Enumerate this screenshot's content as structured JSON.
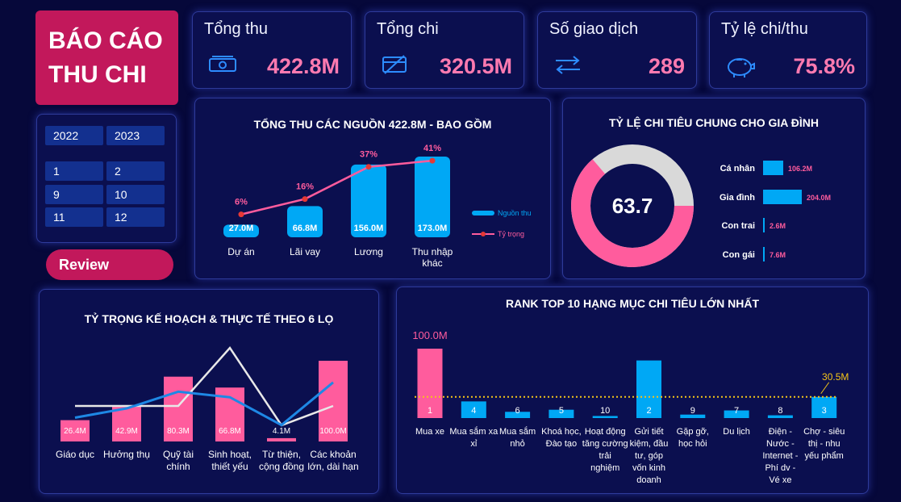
{
  "header": {
    "title_line1": "BÁO CÁO",
    "title_line2": "THU CHI"
  },
  "kpis": [
    {
      "label": "Tổng thu",
      "value": "422.8M",
      "icon": "money-icon"
    },
    {
      "label": "Tổng chi",
      "value": "320.5M",
      "icon": "card-icon"
    },
    {
      "label": "Số giao dịch",
      "value": "289",
      "icon": "transfer-icon"
    },
    {
      "label": "Tỷ lệ chi/thu",
      "value": "75.8%",
      "icon": "piggy-bank-icon"
    }
  ],
  "filters": {
    "years": [
      "2022",
      "2023"
    ],
    "months": [
      "1",
      "2",
      "9",
      "10",
      "11",
      "12"
    ]
  },
  "review_label": "Review",
  "colors": {
    "pink": "#ff5c9d",
    "blue": "#00a8f5",
    "accent": "#c2185b",
    "grey": "#d9d9d9"
  },
  "chart_data": [
    {
      "type": "bar",
      "title": "TỔNG THU CÁC NGUỒN 422.8M - BAO GỒM",
      "categories": [
        "Dự án",
        "Lãi vay",
        "Lương",
        "Thu nhập khác"
      ],
      "series": [
        {
          "name": "Nguồn thu",
          "values": [
            27.0,
            66.8,
            156.0,
            173.0
          ],
          "labels": [
            "27.0M",
            "66.8M",
            "156.0M",
            "173.0M"
          ]
        },
        {
          "name": "Tỷ trọng",
          "values": [
            6,
            16,
            37,
            41
          ],
          "labels": [
            "6%",
            "16%",
            "37%",
            "41%"
          ]
        }
      ],
      "legend": "right"
    },
    {
      "type": "pie",
      "title": "TỶ LỆ CHI TIÊU CHUNG CHO GIA ĐÌNH",
      "center_value": "63.7",
      "donut_fraction": 0.637,
      "categories": [
        "Cá nhân",
        "Gia đình",
        "Con trai",
        "Con gái"
      ],
      "values": [
        106.2,
        204.0,
        2.6,
        7.6
      ],
      "labels": [
        "106.2M",
        "204.0M",
        "2.6M",
        "7.6M"
      ]
    },
    {
      "type": "bar",
      "title": "TỶ TRỌNG KẾ HOẠCH & THỰC TẾ THEO 6 LỌ",
      "categories": [
        "Giáo dục",
        "Hưởng thụ",
        "Quỹ tài chính",
        "Sinh hoạt, thiết yếu",
        "Từ thiện, cộng đồng",
        "Các khoản lớn, dài hạn"
      ],
      "series": [
        {
          "values": [
            26.4,
            42.9,
            80.3,
            66.8,
            4.1,
            100.0
          ],
          "labels": [
            "26.4M",
            "42.9M",
            "80.3M",
            "66.8M",
            "4.1M",
            "100.0M"
          ]
        },
        {
          "values": [
            5,
            10,
            19,
            16,
            1,
            24
          ]
        },
        {
          "values": [
            10,
            10,
            10,
            40,
            0,
            10
          ]
        }
      ]
    },
    {
      "type": "bar",
      "title": "RANK TOP 10 HẠNG MỤC CHI TIÊU LỚN NHẤT",
      "categories": [
        "Mua xe",
        "Mua sắm xa xỉ",
        "Mua sắm nhỏ",
        "Khoá học, Đào tạo",
        "Hoạt động tăng cường trải nghiệm",
        "Gửi tiết kiệm, đầu tư, góp vốn kinh doanh",
        "Gặp gỡ, học hỏi",
        "Du lịch",
        "Điện - Nước - Internet - Phí dv - Vé xe",
        "Chợ - siêu thị - nhu yếu phẩm"
      ],
      "values": [
        100.0,
        24.0,
        9.0,
        12.0,
        3.0,
        83.0,
        5.0,
        11.0,
        4.0,
        30.5
      ],
      "ranks": [
        "1",
        "4",
        "6",
        "5",
        "10",
        "2",
        "9",
        "7",
        "8",
        "3"
      ],
      "annotations": [
        "100.0M",
        "30.5M"
      ],
      "reference_line": 30.5
    }
  ]
}
